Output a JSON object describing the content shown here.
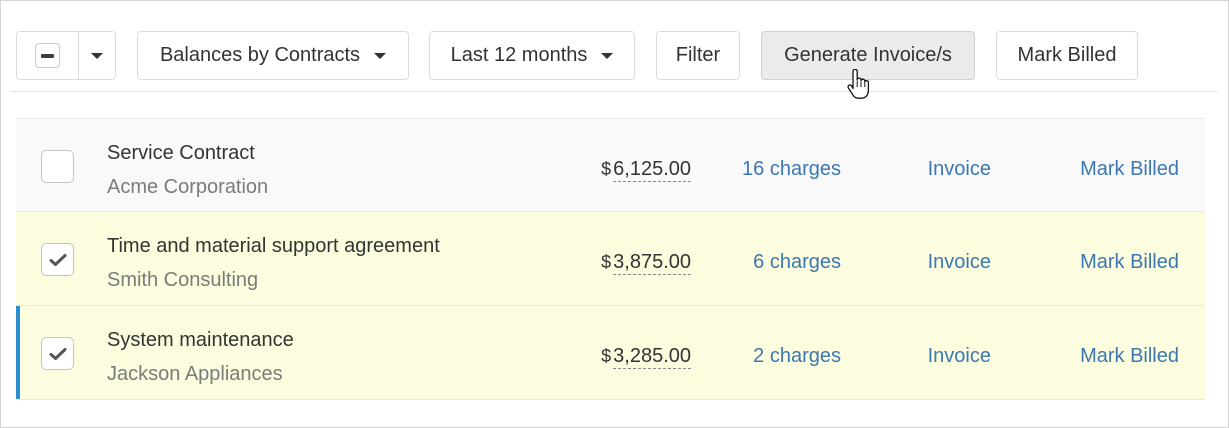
{
  "toolbar": {
    "bulk_select_state": "indeterminate",
    "group_by_label": "Balances by Contracts",
    "period_label": "Last 12 months",
    "filter_label": "Filter",
    "generate_label": "Generate Invoice/s",
    "mark_billed_label": "Mark Billed"
  },
  "colors": {
    "link": "#3b78b3",
    "selected_row": "#fcfcde",
    "unselected_row": "#f9f9f9",
    "focus_bar": "#2f8fce"
  },
  "rows": [
    {
      "checked": false,
      "title": "Service Contract",
      "customer": "Acme Corporation",
      "currency": "$",
      "amount": "6,125.00",
      "charges": "16 charges",
      "invoice": "Invoice",
      "mark_billed": "Mark Billed"
    },
    {
      "checked": true,
      "title": "Time and material support agreement",
      "customer": "Smith Consulting",
      "currency": "$",
      "amount": "3,875.00",
      "charges": "6 charges",
      "invoice": "Invoice",
      "mark_billed": "Mark Billed"
    },
    {
      "checked": true,
      "title": "System maintenance",
      "customer": "Jackson Appliances",
      "currency": "$",
      "amount": "3,285.00",
      "charges": "2 charges",
      "invoice": "Invoice",
      "mark_billed": "Mark Billed"
    }
  ]
}
